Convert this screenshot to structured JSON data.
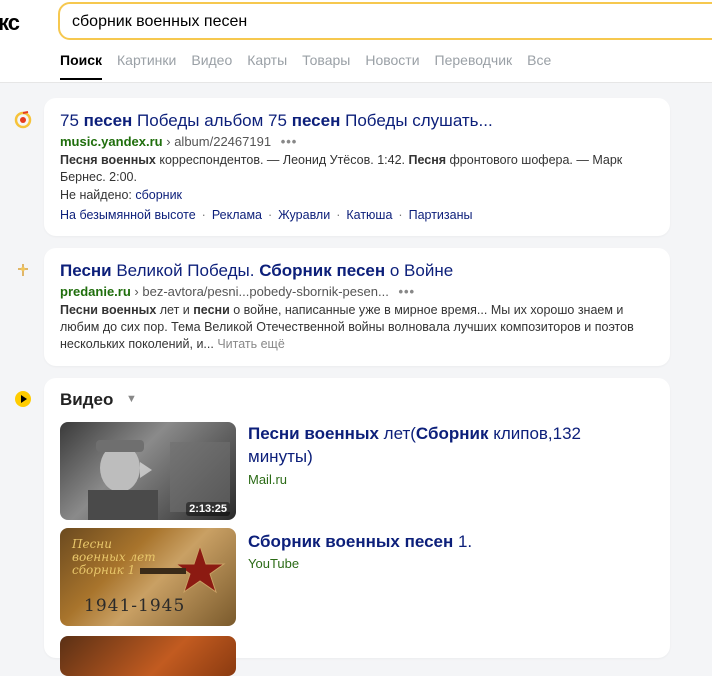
{
  "header": {
    "logo_text": "кс",
    "search": {
      "value": "сборник военных песен"
    },
    "tabs": [
      {
        "label": "Поиск",
        "active": true
      },
      {
        "label": "Картинки"
      },
      {
        "label": "Видео"
      },
      {
        "label": "Карты"
      },
      {
        "label": "Товары"
      },
      {
        "label": "Новости"
      },
      {
        "label": "Переводчик"
      },
      {
        "label": "Все"
      }
    ]
  },
  "results": [
    {
      "title_parts": [
        {
          "text": "75 ",
          "b": false
        },
        {
          "text": "песен",
          "b": true
        },
        {
          "text": " Победы альбом 75 ",
          "b": false
        },
        {
          "text": "песен",
          "b": true
        },
        {
          "text": " Победы слушать...",
          "b": false
        }
      ],
      "host": "music.yandex.ru",
      "path": "album/22467191",
      "snippet_parts": [
        {
          "text": "Песня военных",
          "b": true
        },
        {
          "text": " корреспондентов. — Леонид Утёсов. 1:42. ",
          "b": false
        },
        {
          "text": "Песня",
          "b": true
        },
        {
          "text": " фронтового шофера. — Марк Бернес. 2:00.",
          "b": false
        }
      ],
      "notfound_label": "Не найдено:",
      "notfound_word": "сборник",
      "sitelinks": [
        "На безымянной высоте",
        "Реклама",
        "Журавли",
        "Катюша",
        "Партизаны"
      ]
    },
    {
      "title_parts": [
        {
          "text": "Песни",
          "b": true
        },
        {
          "text": " Великой Победы. ",
          "b": false
        },
        {
          "text": "Сборник песен",
          "b": true
        },
        {
          "text": " о Войне",
          "b": false
        }
      ],
      "host": "predanie.ru",
      "path": "bez-avtora/pesni...pobedy-sbornik-pesen...",
      "snippet_parts": [
        {
          "text": "Песни военных",
          "b": true
        },
        {
          "text": " лет и ",
          "b": false
        },
        {
          "text": "песни",
          "b": true
        },
        {
          "text": " о войне, написанные уже в мирное время... Мы их хорошо знаем и любим до сих пор. Тема Великой Отечественной войны волновала лучших композиторов и поэтов нескольких поколений, и... ",
          "b": false
        }
      ],
      "more_label": "Читать ещё"
    }
  ],
  "video": {
    "heading": "Видео",
    "items": [
      {
        "title_parts": [
          {
            "text": "Песни военных",
            "b": true
          },
          {
            "text": " лет(",
            "b": false
          },
          {
            "text": "Сборник",
            "b": true
          },
          {
            "text": " клипов,132 минуты)",
            "b": false
          }
        ],
        "source": "Mail.ru",
        "duration": "2:13:25"
      },
      {
        "title_parts": [
          {
            "text": "Сборник военных песен",
            "b": true
          },
          {
            "text": " 1.",
            "b": false
          }
        ],
        "source": "YouTube",
        "thumb_caption": "Песни военных лет сборник 1",
        "thumb_year": "1941-1945"
      }
    ]
  },
  "colors": {
    "accent": "#f6c84f",
    "link": "#0c1f7a",
    "url_green": "#2b6b16"
  }
}
